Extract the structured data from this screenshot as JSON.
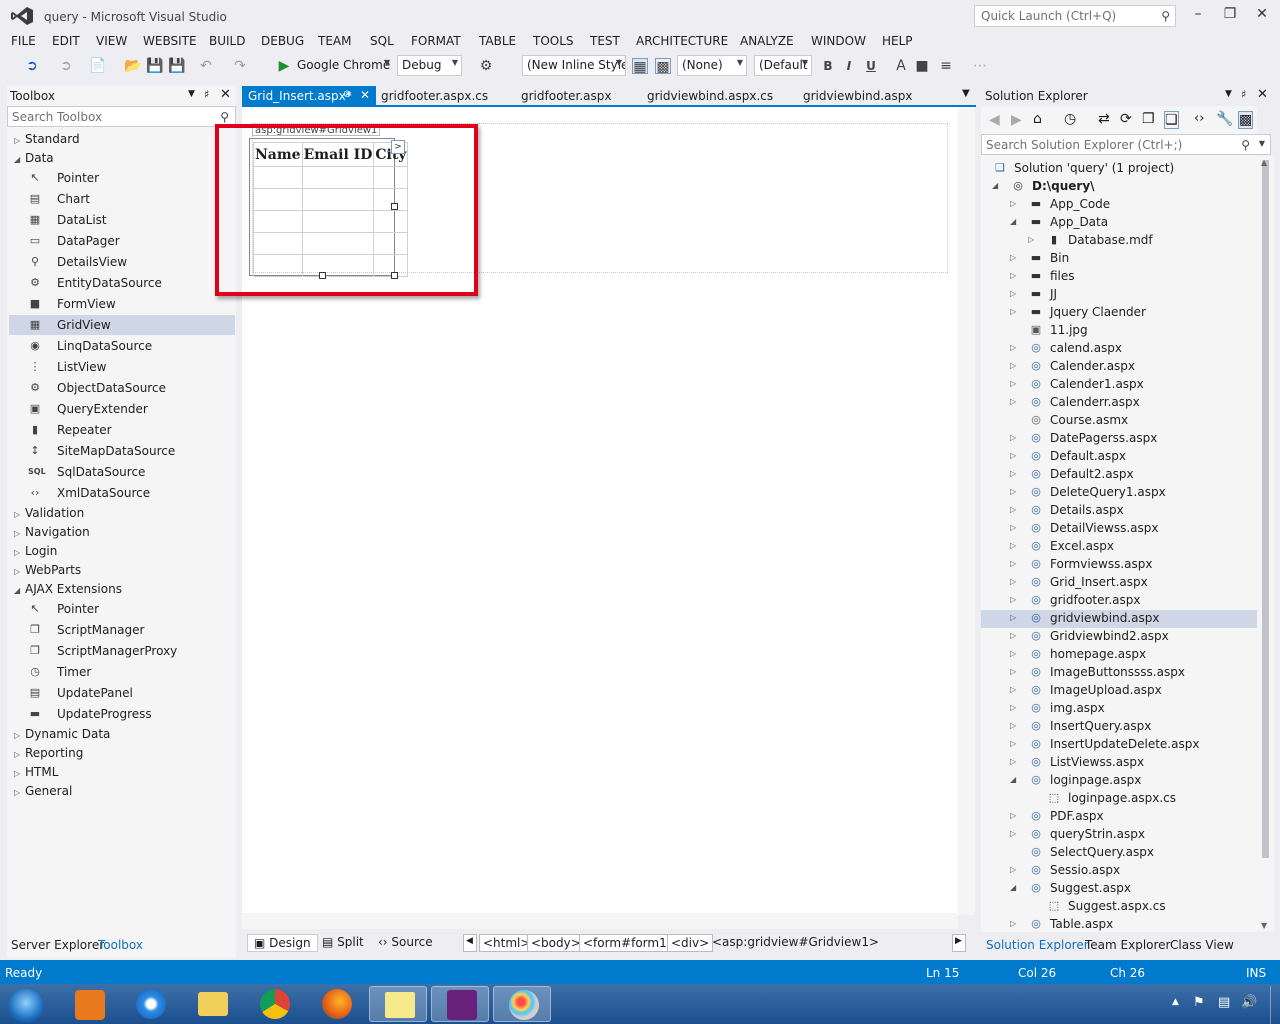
{
  "window": {
    "title": "query - Microsoft Visual Studio",
    "quick_launch_placeholder": "Quick Launch (Ctrl+Q)"
  },
  "menu": [
    "FILE",
    "EDIT",
    "VIEW",
    "WEBSITE",
    "BUILD",
    "DEBUG",
    "TEAM",
    "SQL",
    "FORMAT",
    "TABLE",
    "TOOLS",
    "TEST",
    "ARCHITECTURE",
    "ANALYZE",
    "WINDOW",
    "HELP"
  ],
  "toolbar": {
    "browser": "Google Chrome",
    "config": "Debug",
    "style": "(New Inline Style",
    "target": "(None)",
    "font": "(Default",
    "bold": "B",
    "italic": "I",
    "underline": "U"
  },
  "toolbox": {
    "title": "Toolbox",
    "search_placeholder": "Search Toolbox",
    "categories": {
      "standard": "Standard",
      "data": "Data",
      "validation": "Validation",
      "navigation": "Navigation",
      "login": "Login",
      "webparts": "WebParts",
      "ajax": "AJAX Extensions",
      "dynamic": "Dynamic Data",
      "reporting": "Reporting",
      "html": "HTML",
      "general": "General"
    },
    "data_items": [
      "Pointer",
      "Chart",
      "DataList",
      "DataPager",
      "DetailsView",
      "EntityDataSource",
      "FormView",
      "GridView",
      "LinqDataSource",
      "ListView",
      "ObjectDataSource",
      "QueryExtender",
      "Repeater",
      "SiteMapDataSource",
      "SqlDataSource",
      "XmlDataSource"
    ],
    "ajax_items": [
      "Pointer",
      "ScriptManager",
      "ScriptManagerProxy",
      "Timer",
      "UpdatePanel",
      "UpdateProgress"
    ],
    "bottom_tabs": [
      "Server Explorer",
      "Toolbox"
    ]
  },
  "editor": {
    "tabs": [
      "Grid_Insert.aspx*",
      "gridfooter.aspx.cs",
      "gridfooter.aspx",
      "gridviewbind.aspx.cs",
      "gridviewbind.aspx"
    ],
    "grid_tag": "asp:gridview#Gridview1",
    "grid_headers": [
      "Name",
      "Email ID",
      "City"
    ],
    "grid_empty_rows": 5,
    "smart_tag": ">",
    "view_buttons": [
      "Design",
      "Split",
      "Source"
    ],
    "breadcrumbs": [
      "<html>",
      "<body>",
      "<form#form1>",
      "<div>"
    ],
    "breadcrumb_current": "<asp:gridview#Gridview1>"
  },
  "solution_explorer": {
    "title": "Solution Explorer",
    "search_placeholder": "Search Solution Explorer (Ctrl+;)",
    "solution": "Solution 'query' (1 project)",
    "project": "D:\\query\\",
    "items": [
      {
        "label": "App_Code",
        "icon": "folder-icon",
        "level": 1,
        "expand": "collapsed"
      },
      {
        "label": "App_Data",
        "icon": "folder-icon",
        "level": 1,
        "expand": "expanded"
      },
      {
        "label": "Database.mdf",
        "icon": "database-icon",
        "level": 2,
        "expand": "collapsed"
      },
      {
        "label": "Bin",
        "icon": "folder-icon",
        "level": 1,
        "expand": "collapsed"
      },
      {
        "label": "files",
        "icon": "folder-icon",
        "level": 1,
        "expand": "collapsed"
      },
      {
        "label": "JJ",
        "icon": "folder-icon",
        "level": 1,
        "expand": "collapsed"
      },
      {
        "label": "Jquery Claender",
        "icon": "folder-icon",
        "level": 1,
        "expand": "collapsed"
      },
      {
        "label": "11.jpg",
        "icon": "image-icon",
        "level": 1,
        "expand": "none"
      },
      {
        "label": "calend.aspx",
        "icon": "webpage-icon",
        "level": 1,
        "expand": "collapsed"
      },
      {
        "label": "Calender.aspx",
        "icon": "webpage-icon",
        "level": 1,
        "expand": "collapsed"
      },
      {
        "label": "Calender1.aspx",
        "icon": "webpage-icon",
        "level": 1,
        "expand": "collapsed"
      },
      {
        "label": "Calenderr.aspx",
        "icon": "webpage-icon",
        "level": 1,
        "expand": "collapsed"
      },
      {
        "label": "Course.asmx",
        "icon": "webservice-icon",
        "level": 1,
        "expand": "none"
      },
      {
        "label": "DatePagerss.aspx",
        "icon": "webpage-icon",
        "level": 1,
        "expand": "collapsed"
      },
      {
        "label": "Default.aspx",
        "icon": "webpage-icon",
        "level": 1,
        "expand": "collapsed"
      },
      {
        "label": "Default2.aspx",
        "icon": "webpage-icon",
        "level": 1,
        "expand": "collapsed"
      },
      {
        "label": "DeleteQuery1.aspx",
        "icon": "webpage-icon",
        "level": 1,
        "expand": "collapsed"
      },
      {
        "label": "Details.aspx",
        "icon": "webpage-icon",
        "level": 1,
        "expand": "collapsed"
      },
      {
        "label": "DetailViewss.aspx",
        "icon": "webpage-icon",
        "level": 1,
        "expand": "collapsed"
      },
      {
        "label": "Excel.aspx",
        "icon": "webpage-icon",
        "level": 1,
        "expand": "collapsed"
      },
      {
        "label": "Formviewss.aspx",
        "icon": "webpage-icon",
        "level": 1,
        "expand": "collapsed"
      },
      {
        "label": "Grid_Insert.aspx",
        "icon": "webpage-icon",
        "level": 1,
        "expand": "collapsed"
      },
      {
        "label": "gridfooter.aspx",
        "icon": "webpage-icon",
        "level": 1,
        "expand": "collapsed"
      },
      {
        "label": "gridviewbind.aspx",
        "icon": "webpage-icon",
        "level": 1,
        "expand": "collapsed",
        "selected": true
      },
      {
        "label": "Gridviewbind2.aspx",
        "icon": "webpage-icon",
        "level": 1,
        "expand": "collapsed"
      },
      {
        "label": "homepage.aspx",
        "icon": "webpage-icon",
        "level": 1,
        "expand": "collapsed"
      },
      {
        "label": "ImageButtonssss.aspx",
        "icon": "webpage-icon",
        "level": 1,
        "expand": "collapsed"
      },
      {
        "label": "ImageUpload.aspx",
        "icon": "webpage-icon",
        "level": 1,
        "expand": "collapsed"
      },
      {
        "label": "img.aspx",
        "icon": "webpage-icon",
        "level": 1,
        "expand": "collapsed"
      },
      {
        "label": "InsertQuery.aspx",
        "icon": "webpage-icon",
        "level": 1,
        "expand": "collapsed"
      },
      {
        "label": "InsertUpdateDelete.aspx",
        "icon": "webpage-icon",
        "level": 1,
        "expand": "collapsed"
      },
      {
        "label": "ListViewss.aspx",
        "icon": "webpage-icon",
        "level": 1,
        "expand": "collapsed"
      },
      {
        "label": "loginpage.aspx",
        "icon": "webpage-icon",
        "level": 1,
        "expand": "expanded"
      },
      {
        "label": "loginpage.aspx.cs",
        "icon": "codefile-icon",
        "level": 2,
        "expand": "none"
      },
      {
        "label": "PDF.aspx",
        "icon": "webpage-icon",
        "level": 1,
        "expand": "collapsed"
      },
      {
        "label": "queryStrin.aspx",
        "icon": "webpage-icon",
        "level": 1,
        "expand": "collapsed"
      },
      {
        "label": "SelectQuery.aspx",
        "icon": "webpage-icon",
        "level": 1,
        "expand": "none"
      },
      {
        "label": "Sessio.aspx",
        "icon": "webpage-icon",
        "level": 1,
        "expand": "collapsed"
      },
      {
        "label": "Suggest.aspx",
        "icon": "webpage-icon",
        "level": 1,
        "expand": "expanded"
      },
      {
        "label": "Suggest.aspx.cs",
        "icon": "codefile-icon",
        "level": 2,
        "expand": "none"
      },
      {
        "label": "Table.aspx",
        "icon": "webpage-icon",
        "level": 1,
        "expand": "collapsed"
      }
    ],
    "bottom_tabs": [
      "Solution Explorer",
      "Team Explorer",
      "Class View"
    ]
  },
  "status": {
    "state": "Ready",
    "ln": "Ln 15",
    "col": "Col 26",
    "ch": "Ch 26",
    "mode": "INS"
  },
  "colors": {
    "accent": "#007acc",
    "highlight_box": "#e0001a",
    "selection": "#cfd6e5"
  }
}
